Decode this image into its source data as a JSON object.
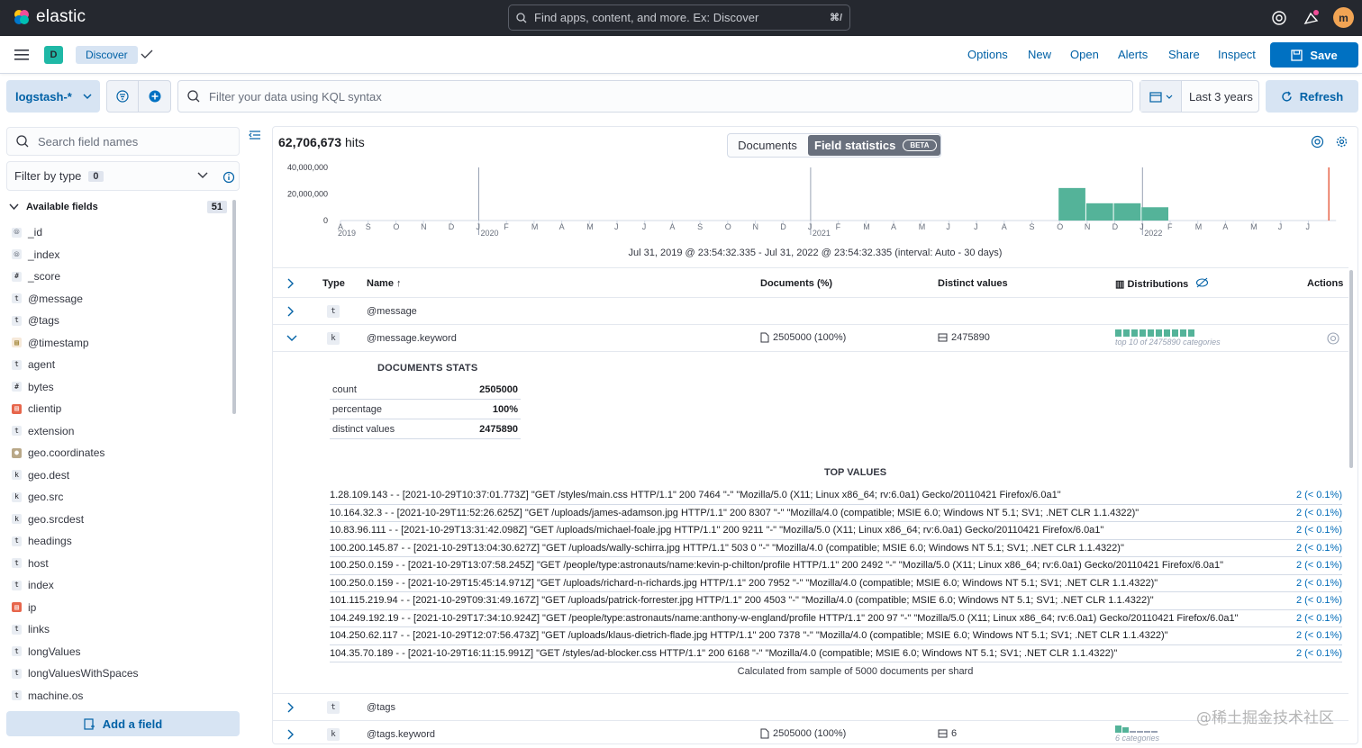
{
  "topbar": {
    "logo_text": "elastic",
    "search_placeholder": "Find apps, content, and more. Ex: Discover",
    "search_shortcut": "⌘/",
    "avatar_initial": "m"
  },
  "appbar": {
    "space_initial": "D",
    "breadcrumb": "Discover",
    "links": [
      "Options",
      "New",
      "Open",
      "Alerts",
      "Share",
      "Inspect"
    ],
    "save_label": "Save"
  },
  "querybar": {
    "data_view": "logstash-*",
    "kql_placeholder": "Filter your data using KQL syntax",
    "date_range": "Last 3 years",
    "refresh_label": "Refresh"
  },
  "sidebar": {
    "search_placeholder": "Search field names",
    "filter_label": "Filter by type",
    "filter_count": "0",
    "available_label": "Available fields",
    "available_count": "51",
    "fields": [
      {
        "name": "_id",
        "type": "id"
      },
      {
        "name": "_index",
        "type": "id"
      },
      {
        "name": "_score",
        "type": "number"
      },
      {
        "name": "@message",
        "type": "text"
      },
      {
        "name": "@tags",
        "type": "text"
      },
      {
        "name": "@timestamp",
        "type": "date"
      },
      {
        "name": "agent",
        "type": "text"
      },
      {
        "name": "bytes",
        "type": "number"
      },
      {
        "name": "clientip",
        "type": "ip"
      },
      {
        "name": "extension",
        "type": "text"
      },
      {
        "name": "geo.coordinates",
        "type": "geo"
      },
      {
        "name": "geo.dest",
        "type": "keyword"
      },
      {
        "name": "geo.src",
        "type": "keyword"
      },
      {
        "name": "geo.srcdest",
        "type": "keyword"
      },
      {
        "name": "headings",
        "type": "text"
      },
      {
        "name": "host",
        "type": "text"
      },
      {
        "name": "index",
        "type": "text"
      },
      {
        "name": "ip",
        "type": "ip"
      },
      {
        "name": "links",
        "type": "text"
      },
      {
        "name": "longValues",
        "type": "text"
      },
      {
        "name": "longValuesWithSpaces",
        "type": "text"
      },
      {
        "name": "machine.os",
        "type": "text"
      }
    ],
    "add_field_label": "Add a field"
  },
  "main": {
    "hits_count": "62,706,673",
    "hits_label": "hits",
    "tab_documents": "Documents",
    "tab_field_stats": "Field statistics",
    "tab_beta": "BETA",
    "range_text": "Jul 31, 2019 @ 23:54:32.335 - Jul 31, 2022 @ 23:54:32.335 (interval: Auto - 30 days)",
    "columns": {
      "type": "Type",
      "name": "Name",
      "documents": "Documents (%)",
      "distinct": "Distinct values",
      "distributions": "Distributions",
      "actions": "Actions"
    },
    "rows": [
      {
        "type_token": "t",
        "name": "@message",
        "documents": "",
        "distinct": "",
        "dist_label": ""
      },
      {
        "type_token": "k",
        "name": "@message.keyword",
        "documents": "2505000 (100%)",
        "distinct": "2475890",
        "dist_label": "top 10 of 2475890 categories"
      },
      {
        "type_token": "t",
        "name": "@tags",
        "documents": "",
        "distinct": "",
        "dist_label": ""
      },
      {
        "type_token": "k",
        "name": "@tags.keyword",
        "documents": "2505000 (100%)",
        "distinct": "6",
        "dist_label": "6 categories"
      }
    ],
    "doc_stats": {
      "title": "DOCUMENTS STATS",
      "rows": [
        {
          "label": "count",
          "value": "2505000"
        },
        {
          "label": "percentage",
          "value": "100%"
        },
        {
          "label": "distinct values",
          "value": "2475890"
        }
      ]
    },
    "top_values": {
      "title": "TOP VALUES",
      "items": [
        {
          "text": "1.28.109.143 - - [2021-10-29T10:37:01.773Z] \"GET /styles/main.css HTTP/1.1\" 200 7464 \"-\" \"Mozilla/5.0 (X11; Linux x86_64; rv:6.0a1) Gecko/20110421 Firefox/6.0a1\"",
          "pct": "2 (< 0.1%)"
        },
        {
          "text": "10.164.32.3 - - [2021-10-29T11:52:26.625Z] \"GET /uploads/james-adamson.jpg HTTP/1.1\" 200 8307 \"-\" \"Mozilla/4.0 (compatible; MSIE 6.0; Windows NT 5.1; SV1; .NET CLR 1.1.4322)\"",
          "pct": "2 (< 0.1%)"
        },
        {
          "text": "10.83.96.111 - - [2021-10-29T13:31:42.098Z] \"GET /uploads/michael-foale.jpg HTTP/1.1\" 200 9211 \"-\" \"Mozilla/5.0 (X11; Linux x86_64; rv:6.0a1) Gecko/20110421 Firefox/6.0a1\"",
          "pct": "2 (< 0.1%)"
        },
        {
          "text": "100.200.145.87 - - [2021-10-29T13:04:30.627Z] \"GET /uploads/wally-schirra.jpg HTTP/1.1\" 503 0 \"-\" \"Mozilla/4.0 (compatible; MSIE 6.0; Windows NT 5.1; SV1; .NET CLR 1.1.4322)\"",
          "pct": "2 (< 0.1%)"
        },
        {
          "text": "100.250.0.159 - - [2021-10-29T13:07:58.245Z] \"GET /people/type:astronauts/name:kevin-p-chilton/profile HTTP/1.1\" 200 2492 \"-\" \"Mozilla/5.0 (X11; Linux x86_64; rv:6.0a1) Gecko/20110421 Firefox/6.0a1\"",
          "pct": "2 (< 0.1%)"
        },
        {
          "text": "100.250.0.159 - - [2021-10-29T15:45:14.971Z] \"GET /uploads/richard-n-richards.jpg HTTP/1.1\" 200 7952 \"-\" \"Mozilla/4.0 (compatible; MSIE 6.0; Windows NT 5.1; SV1; .NET CLR 1.1.4322)\"",
          "pct": "2 (< 0.1%)"
        },
        {
          "text": "101.115.219.94 - - [2021-10-29T09:31:49.167Z] \"GET /uploads/patrick-forrester.jpg HTTP/1.1\" 200 4503 \"-\" \"Mozilla/4.0 (compatible; MSIE 6.0; Windows NT 5.1; SV1; .NET CLR 1.1.4322)\"",
          "pct": "2 (< 0.1%)"
        },
        {
          "text": "104.249.192.19 - - [2021-10-29T17:34:10.924Z] \"GET /people/type:astronauts/name:anthony-w-england/profile HTTP/1.1\" 200 97 \"-\" \"Mozilla/5.0 (X11; Linux x86_64; rv:6.0a1) Gecko/20110421 Firefox/6.0a1\"",
          "pct": "2 (< 0.1%)"
        },
        {
          "text": "104.250.62.117 - - [2021-10-29T12:07:56.473Z] \"GET /uploads/klaus-dietrich-flade.jpg HTTP/1.1\" 200 7378 \"-\" \"Mozilla/4.0 (compatible; MSIE 6.0; Windows NT 5.1; SV1; .NET CLR 1.1.4322)\"",
          "pct": "2 (< 0.1%)"
        },
        {
          "text": "104.35.70.189 - - [2021-10-29T16:11:15.991Z] \"GET /styles/ad-blocker.css HTTP/1.1\" 200 6168 \"-\" \"Mozilla/4.0 (compatible; MSIE 6.0; Windows NT 5.1; SV1; .NET CLR 1.1.4322)\"",
          "pct": "2 (< 0.1%)"
        }
      ],
      "sample_note": "Calculated from sample of 5000 documents per shard"
    }
  },
  "chart_data": {
    "type": "bar",
    "title": "",
    "xlabel": "",
    "ylabel": "",
    "ylim": [
      0,
      40000000
    ],
    "yticks": [
      "40,000,000",
      "20,000,000",
      "0"
    ],
    "ytick_values": [
      40000000,
      20000000,
      0
    ],
    "x_month_ticks": [
      "A",
      "S",
      "O",
      "N",
      "D",
      "J",
      "F",
      "M",
      "A",
      "M",
      "J",
      "J",
      "A",
      "S",
      "O",
      "N",
      "D",
      "J",
      "F",
      "M",
      "A",
      "M",
      "J",
      "J",
      "A",
      "S",
      "O",
      "N",
      "D",
      "J",
      "F",
      "M",
      "A",
      "M",
      "J",
      "J"
    ],
    "x_year_labels": [
      {
        "label": "2019",
        "month_index": 0
      },
      {
        "label": "2020",
        "month_index": 5
      },
      {
        "label": "2021",
        "month_index": 17
      },
      {
        "label": "2022",
        "month_index": 29
      }
    ],
    "categories": [
      "2021-09",
      "2021-10",
      "2021-11",
      "2021-12",
      "2022-01"
    ],
    "category_month_index": [
      26,
      27,
      28,
      29,
      30
    ],
    "values": [
      24500000,
      13000000,
      13000000,
      10000000
    ],
    "bar_month_index": [
      26,
      27,
      28,
      29
    ],
    "bar_color": "#54b399",
    "now_marker_month_index": 36,
    "now_marker_color": "#e7664c",
    "grid": false
  },
  "colors": {
    "accent": "#0071c2",
    "header_bg": "#25282f"
  }
}
